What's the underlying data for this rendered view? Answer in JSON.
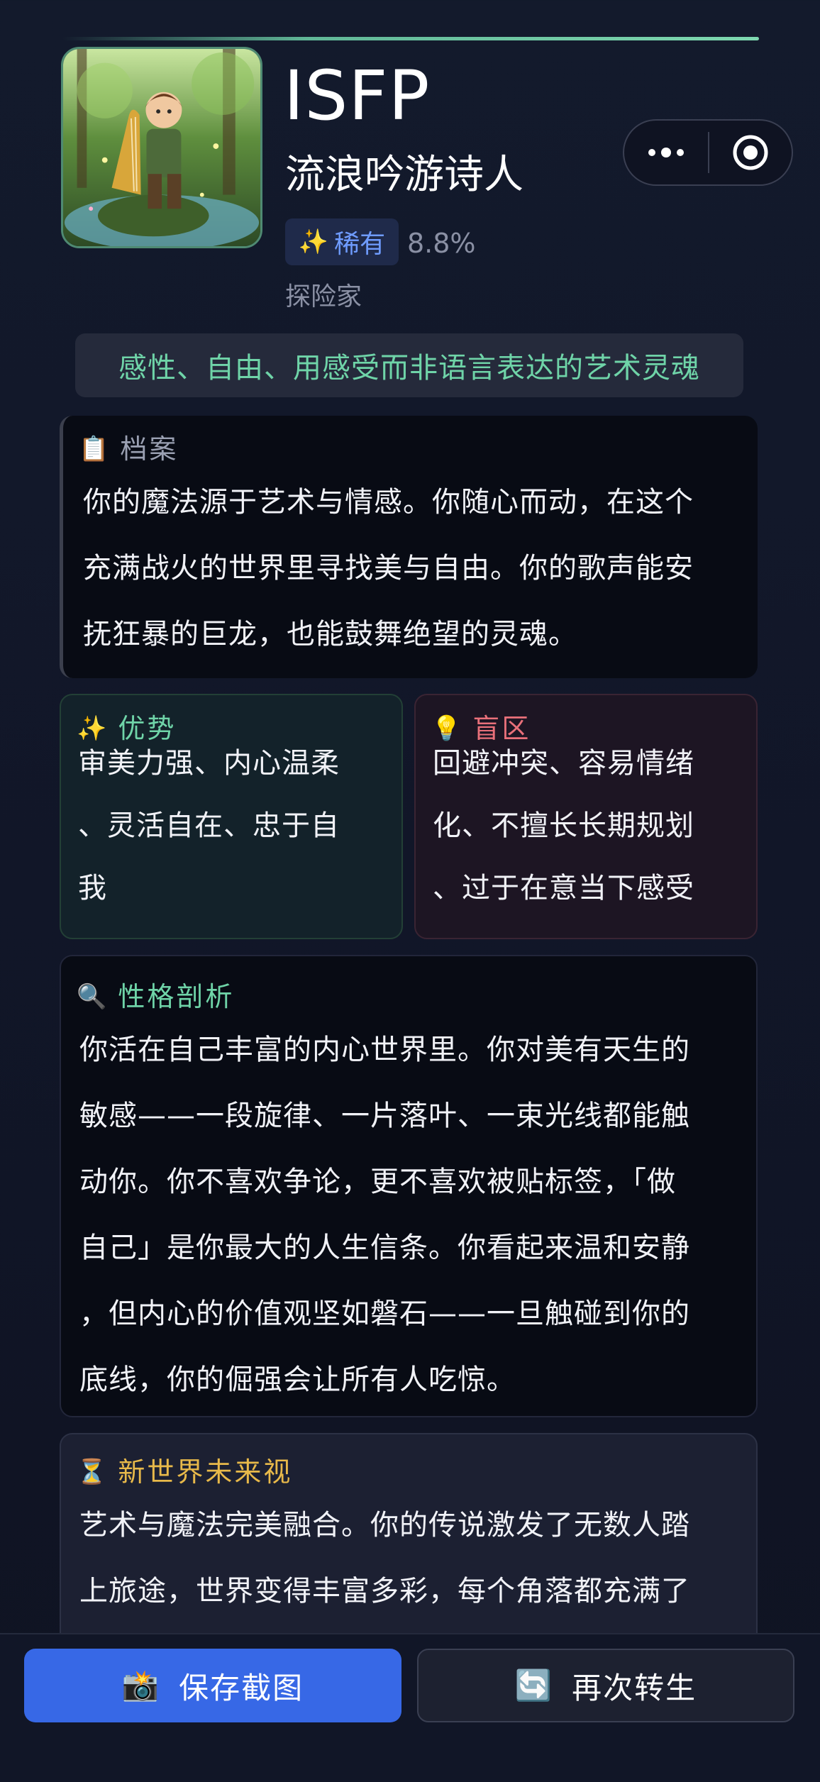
{
  "header": {
    "type": "ISFP",
    "name": "流浪吟游诗人",
    "rarity_label": "稀有",
    "rarity_percent": "8.8%",
    "role": "探险家",
    "tagline": "感性、自由、用感受而非语言表达的艺术灵魂"
  },
  "capsule": {
    "more_icon": "more-dots-icon",
    "target_icon": "target-circle-icon"
  },
  "profile": {
    "icon": "📋",
    "title": "档案",
    "lines": [
      "你的魔法源于艺术与情感。你随心而动，在这个",
      "充满战火的世界里寻找美与自由。你的歌声能安",
      "抚狂暴的巨龙，也能鼓舞绝望的灵魂。"
    ]
  },
  "strengths": {
    "icon": "✨",
    "title": "优势",
    "lines": [
      "审美力强、内心温柔",
      "、灵活自在、忠于自",
      "我"
    ]
  },
  "blindspots": {
    "icon": "💡",
    "title": "盲区",
    "lines": [
      "回避冲突、容易情绪",
      "化、不擅长长期规划",
      "、过于在意当下感受"
    ]
  },
  "analysis": {
    "icon": "🔍",
    "title": "性格剖析",
    "lines": [
      "你活在自己丰富的内心世界里。你对美有天生的",
      "敏感——一段旋律、一片落叶、一束光线都能触",
      "动你。你不喜欢争论，更不喜欢被贴标签，「做",
      "自己」是你最大的人生信条。你看起来温和安静",
      "，但内心的价值观坚如磐石——一旦触碰到你的",
      "底线，你的倔强会让所有人吃惊。"
    ]
  },
  "future": {
    "icon": "⏳",
    "title": "新世界未来视",
    "lines": [
      "艺术与魔法完美融合。你的传说激发了无数人踏",
      "上旅途，世界变得丰富多彩，每个角落都充满了"
    ]
  },
  "actions": {
    "save": {
      "icon": "📸",
      "label": "保存截图"
    },
    "again": {
      "icon": "🔄",
      "label": "再次转生"
    }
  },
  "colors": {
    "accent_green": "#6fd4a8",
    "accent_red": "#e9707a",
    "accent_gold": "#e8b94a",
    "button_blue": "#3768e6"
  }
}
